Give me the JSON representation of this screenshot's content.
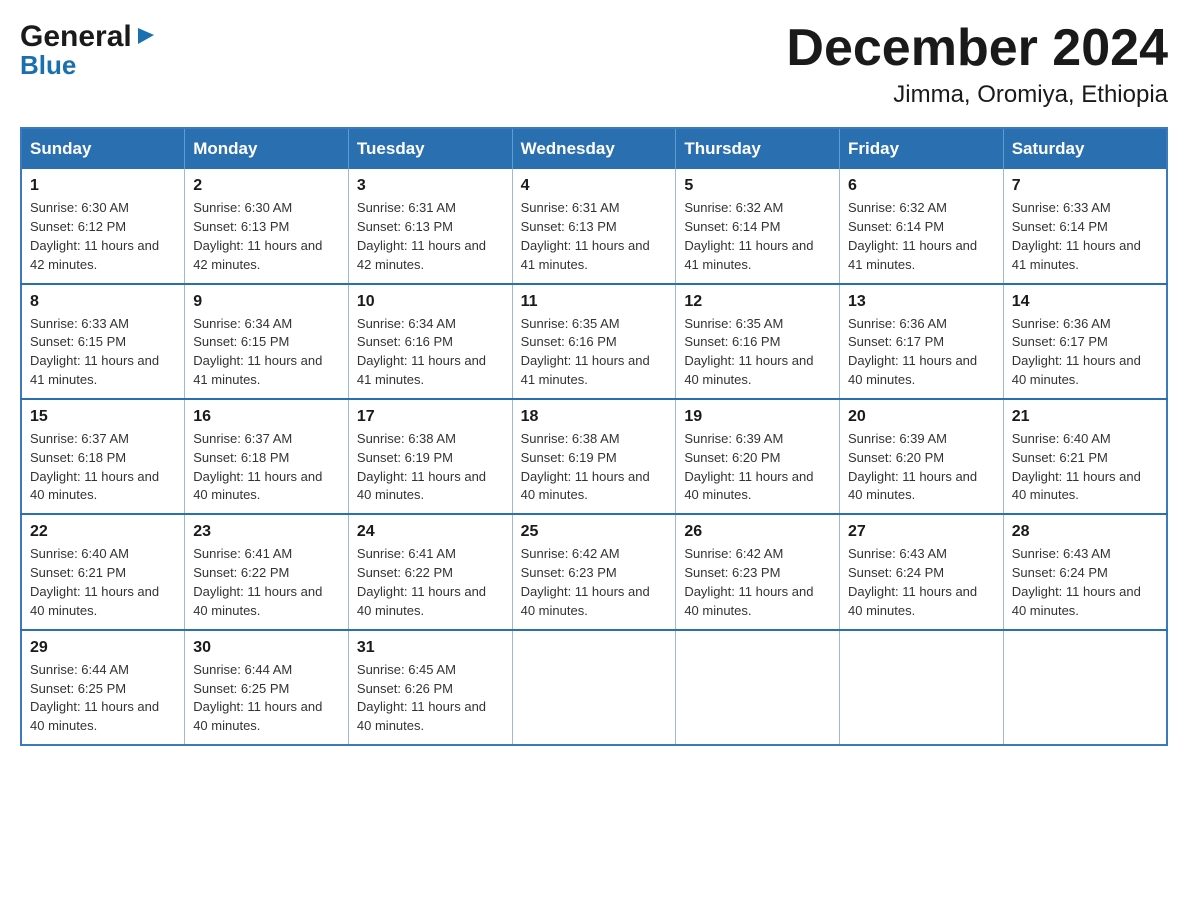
{
  "logo": {
    "general": "General",
    "blue": "Blue",
    "triangle": "▶"
  },
  "title": "December 2024",
  "subtitle": "Jimma, Oromiya, Ethiopia",
  "days_of_week": [
    "Sunday",
    "Monday",
    "Tuesday",
    "Wednesday",
    "Thursday",
    "Friday",
    "Saturday"
  ],
  "weeks": [
    [
      {
        "day": "1",
        "sunrise": "6:30 AM",
        "sunset": "6:12 PM",
        "daylight": "11 hours and 42 minutes."
      },
      {
        "day": "2",
        "sunrise": "6:30 AM",
        "sunset": "6:13 PM",
        "daylight": "11 hours and 42 minutes."
      },
      {
        "day": "3",
        "sunrise": "6:31 AM",
        "sunset": "6:13 PM",
        "daylight": "11 hours and 42 minutes."
      },
      {
        "day": "4",
        "sunrise": "6:31 AM",
        "sunset": "6:13 PM",
        "daylight": "11 hours and 41 minutes."
      },
      {
        "day": "5",
        "sunrise": "6:32 AM",
        "sunset": "6:14 PM",
        "daylight": "11 hours and 41 minutes."
      },
      {
        "day": "6",
        "sunrise": "6:32 AM",
        "sunset": "6:14 PM",
        "daylight": "11 hours and 41 minutes."
      },
      {
        "day": "7",
        "sunrise": "6:33 AM",
        "sunset": "6:14 PM",
        "daylight": "11 hours and 41 minutes."
      }
    ],
    [
      {
        "day": "8",
        "sunrise": "6:33 AM",
        "sunset": "6:15 PM",
        "daylight": "11 hours and 41 minutes."
      },
      {
        "day": "9",
        "sunrise": "6:34 AM",
        "sunset": "6:15 PM",
        "daylight": "11 hours and 41 minutes."
      },
      {
        "day": "10",
        "sunrise": "6:34 AM",
        "sunset": "6:16 PM",
        "daylight": "11 hours and 41 minutes."
      },
      {
        "day": "11",
        "sunrise": "6:35 AM",
        "sunset": "6:16 PM",
        "daylight": "11 hours and 41 minutes."
      },
      {
        "day": "12",
        "sunrise": "6:35 AM",
        "sunset": "6:16 PM",
        "daylight": "11 hours and 40 minutes."
      },
      {
        "day": "13",
        "sunrise": "6:36 AM",
        "sunset": "6:17 PM",
        "daylight": "11 hours and 40 minutes."
      },
      {
        "day": "14",
        "sunrise": "6:36 AM",
        "sunset": "6:17 PM",
        "daylight": "11 hours and 40 minutes."
      }
    ],
    [
      {
        "day": "15",
        "sunrise": "6:37 AM",
        "sunset": "6:18 PM",
        "daylight": "11 hours and 40 minutes."
      },
      {
        "day": "16",
        "sunrise": "6:37 AM",
        "sunset": "6:18 PM",
        "daylight": "11 hours and 40 minutes."
      },
      {
        "day": "17",
        "sunrise": "6:38 AM",
        "sunset": "6:19 PM",
        "daylight": "11 hours and 40 minutes."
      },
      {
        "day": "18",
        "sunrise": "6:38 AM",
        "sunset": "6:19 PM",
        "daylight": "11 hours and 40 minutes."
      },
      {
        "day": "19",
        "sunrise": "6:39 AM",
        "sunset": "6:20 PM",
        "daylight": "11 hours and 40 minutes."
      },
      {
        "day": "20",
        "sunrise": "6:39 AM",
        "sunset": "6:20 PM",
        "daylight": "11 hours and 40 minutes."
      },
      {
        "day": "21",
        "sunrise": "6:40 AM",
        "sunset": "6:21 PM",
        "daylight": "11 hours and 40 minutes."
      }
    ],
    [
      {
        "day": "22",
        "sunrise": "6:40 AM",
        "sunset": "6:21 PM",
        "daylight": "11 hours and 40 minutes."
      },
      {
        "day": "23",
        "sunrise": "6:41 AM",
        "sunset": "6:22 PM",
        "daylight": "11 hours and 40 minutes."
      },
      {
        "day": "24",
        "sunrise": "6:41 AM",
        "sunset": "6:22 PM",
        "daylight": "11 hours and 40 minutes."
      },
      {
        "day": "25",
        "sunrise": "6:42 AM",
        "sunset": "6:23 PM",
        "daylight": "11 hours and 40 minutes."
      },
      {
        "day": "26",
        "sunrise": "6:42 AM",
        "sunset": "6:23 PM",
        "daylight": "11 hours and 40 minutes."
      },
      {
        "day": "27",
        "sunrise": "6:43 AM",
        "sunset": "6:24 PM",
        "daylight": "11 hours and 40 minutes."
      },
      {
        "day": "28",
        "sunrise": "6:43 AM",
        "sunset": "6:24 PM",
        "daylight": "11 hours and 40 minutes."
      }
    ],
    [
      {
        "day": "29",
        "sunrise": "6:44 AM",
        "sunset": "6:25 PM",
        "daylight": "11 hours and 40 minutes."
      },
      {
        "day": "30",
        "sunrise": "6:44 AM",
        "sunset": "6:25 PM",
        "daylight": "11 hours and 40 minutes."
      },
      {
        "day": "31",
        "sunrise": "6:45 AM",
        "sunset": "6:26 PM",
        "daylight": "11 hours and 40 minutes."
      },
      null,
      null,
      null,
      null
    ]
  ]
}
